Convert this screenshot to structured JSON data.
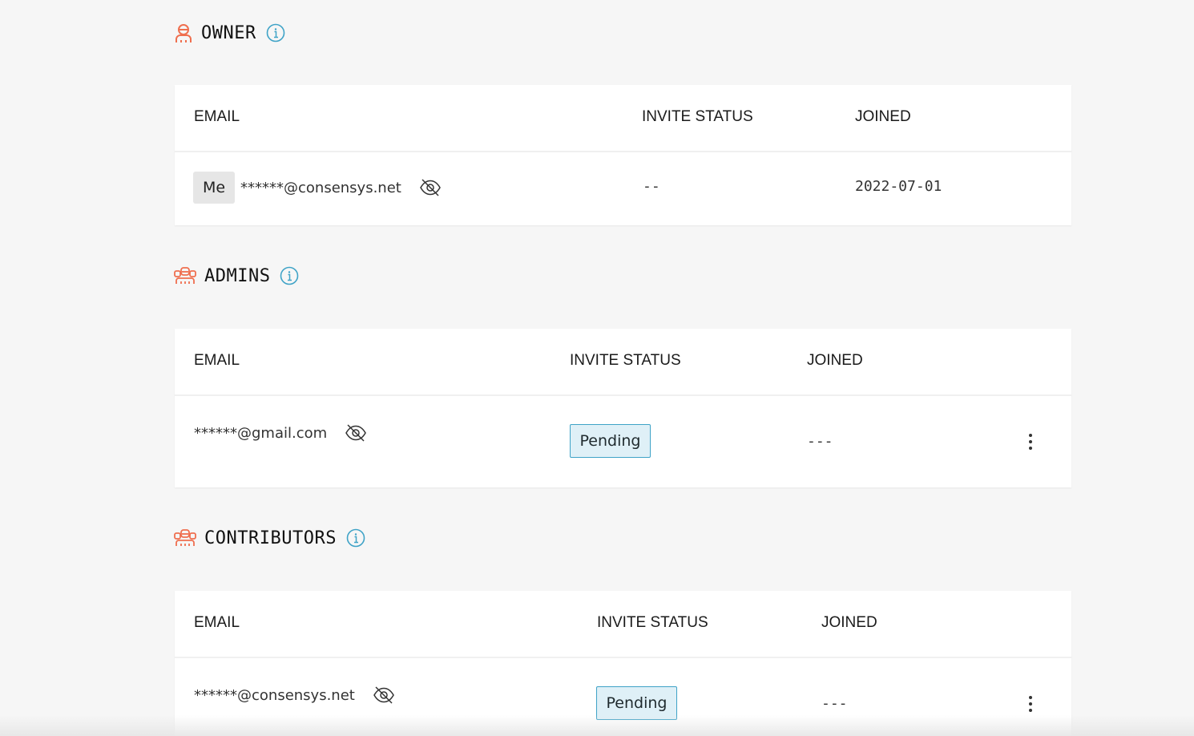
{
  "colors": {
    "accent": "#ef6f4f",
    "info": "#3fa3c7",
    "pending_bg": "#dff0f7",
    "badge_bg": "#e6e6e6"
  },
  "owner": {
    "title": "OWNER",
    "icon": "user-avatar-icon",
    "headers": {
      "email": "EMAIL",
      "invite_status": "INVITE STATUS",
      "joined": "JOINED"
    },
    "rows": [
      {
        "badge": "Me",
        "email": "******@consensys.net",
        "invite_status": "--",
        "joined": "2022-07-01"
      }
    ]
  },
  "admins": {
    "title": "ADMINS",
    "icon": "group-icon",
    "headers": {
      "email": "EMAIL",
      "invite_status": "INVITE STATUS",
      "joined": "JOINED"
    },
    "rows": [
      {
        "email": "******@gmail.com",
        "invite_status": "Pending",
        "joined": "---"
      }
    ]
  },
  "contributors": {
    "title": "CONTRIBUTORS",
    "icon": "group-icon",
    "headers": {
      "email": "EMAIL",
      "invite_status": "INVITE STATUS",
      "joined": "JOINED"
    },
    "rows": [
      {
        "email": "******@consensys.net",
        "invite_status": "Pending",
        "joined": "---"
      }
    ]
  }
}
